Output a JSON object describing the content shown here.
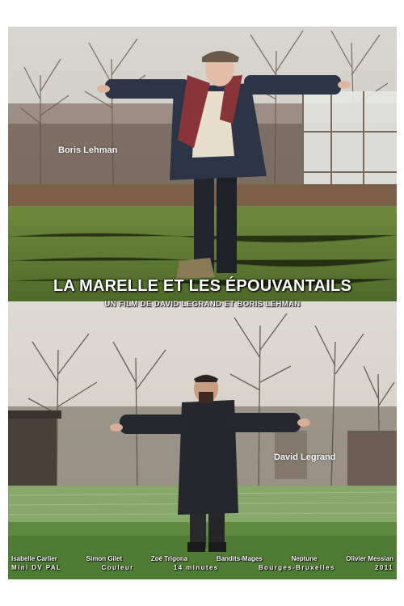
{
  "poster": {
    "title": "LA MARELLE ET LES ÉPOUVANTAILS",
    "subtitle": "UN FILM DE DAVID LEGRAND ET BORIS LEHMAN",
    "labels": {
      "top_person": "Boris Lehman",
      "bottom_person": "David Legrand"
    },
    "cast": [
      "Isabelle Carlier",
      "Simon Gilet",
      "Zoé Trigona",
      "Bandits-Mages",
      "Neptune",
      "Olivier Messian"
    ],
    "tech": [
      "Mini DV PAL",
      "Couleur",
      "14 minutes",
      "Bourges-Bruxelles",
      "2011"
    ]
  }
}
